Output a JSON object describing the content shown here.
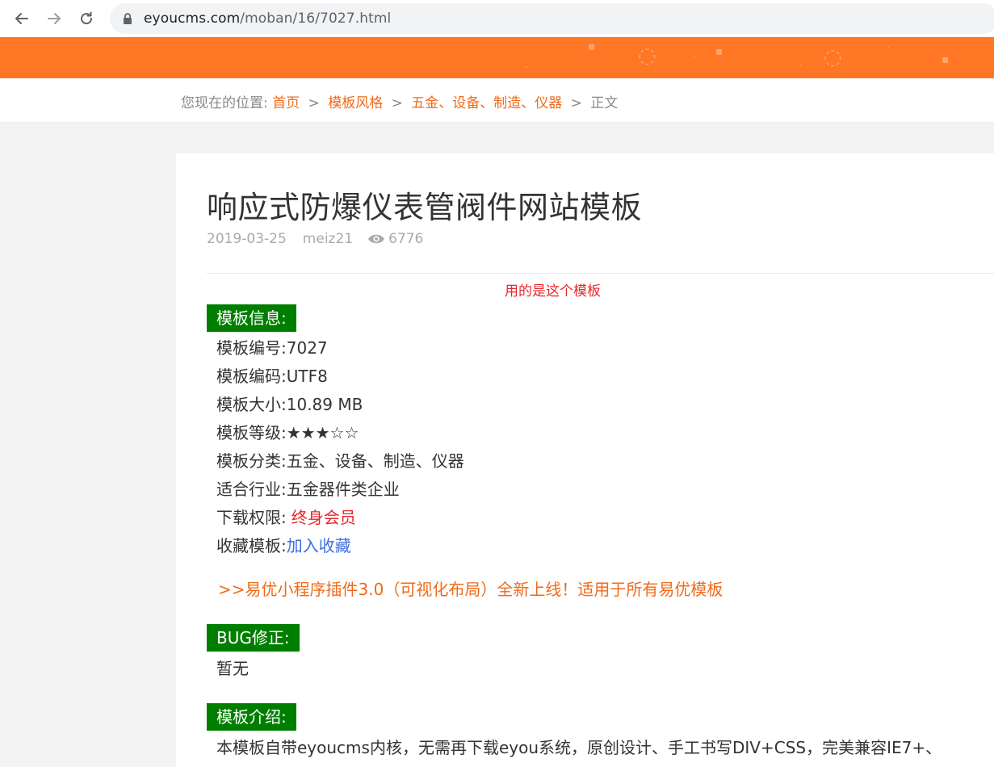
{
  "browser": {
    "url_host": "eyoucms.com",
    "url_path": "/moban/16/7027.html"
  },
  "breadcrumb": {
    "prefix": "您现在的位置:",
    "items": [
      "首页",
      "模板风格",
      "五金、设备、制造、仪器"
    ],
    "current": "正文",
    "separator": ">"
  },
  "article": {
    "title": "响应式防爆仪表管阀件网站模板",
    "date": "2019-03-25",
    "author": "meiz21",
    "views": "6776",
    "note": "用的是这个模板"
  },
  "template_info": {
    "label": "模板信息:",
    "rows": [
      {
        "key": "模板编号:",
        "value": "7027"
      },
      {
        "key": "模板编码:",
        "value": "UTF8"
      },
      {
        "key": "模板大小:",
        "value": "10.89 MB"
      },
      {
        "key": "模板等级:",
        "value": "★★★☆☆"
      },
      {
        "key": "模板分类:",
        "value": "五金、设备、制造、仪器"
      },
      {
        "key": "适合行业:",
        "value": "五金器件类企业"
      },
      {
        "key": "下载权限:",
        "value": "终身会员"
      },
      {
        "key": "收藏模板:",
        "value": "加入收藏"
      }
    ]
  },
  "promo": ">>易优小程序插件3.0（可视化布局）全新上线！适用于所有易优模板",
  "bug_fix": {
    "label": "BUG修正:",
    "text": "暂无"
  },
  "intro": {
    "label": "模板介绍:",
    "text": "本模板自带eyoucms内核，无需再下载eyou系统，原创设计、手工书写DIV+CSS，完美兼容IE7+、"
  },
  "colors": {
    "header": "#ff7624",
    "accent": "#f06a18",
    "section_label": "#007e00",
    "red": "#e8262b",
    "link": "#3b6ee0"
  }
}
